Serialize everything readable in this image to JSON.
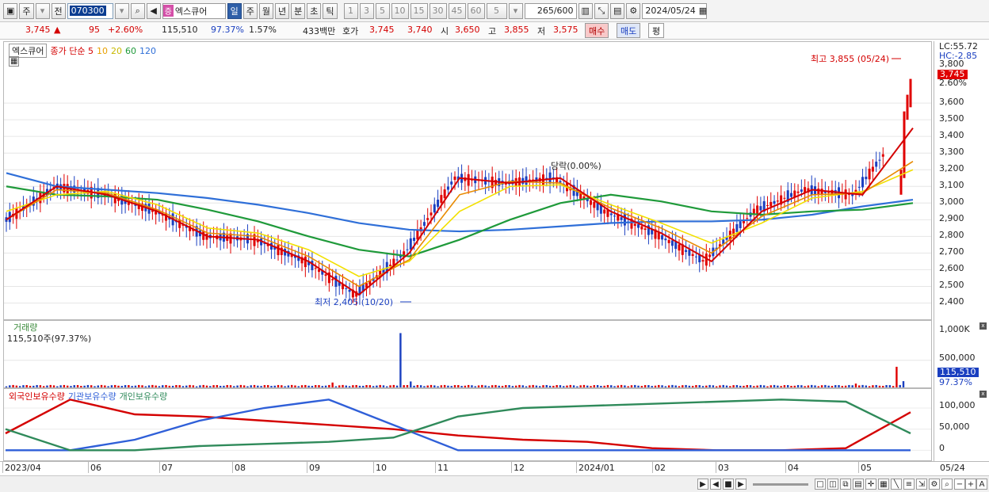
{
  "toolbar": {
    "mode_labels": [
      "주",
      "전"
    ],
    "code": "070300",
    "stock_name": "엑스큐어",
    "name_badge": "증",
    "periods": [
      "일",
      "주",
      "월",
      "년",
      "분",
      "초",
      "틱"
    ],
    "active_period": "일",
    "minutes": [
      "1",
      "3",
      "5",
      "10",
      "15",
      "30",
      "45",
      "60"
    ],
    "interval_value": "5",
    "count": "265",
    "count_total": "/600",
    "date": "2024/05/24"
  },
  "quote": {
    "price": "3,745",
    "change": "95",
    "change_pct": "+2.60%",
    "volume": "115,510",
    "vol_ratio": "97.37%",
    "turnover": "1.57%",
    "amount": "433백만",
    "bid_label": "호가",
    "ask": "3,745",
    "bid": "3,740",
    "open_label": "시",
    "open": "3,650",
    "high_label": "고",
    "high": "3,855",
    "low_label": "저",
    "low": "3,575",
    "buy": "매수",
    "sell": "매도",
    "avg": "평"
  },
  "price_panel": {
    "stock_tag": "엑스큐어",
    "legend": [
      {
        "label": "종가 단순 5",
        "color": "#d40000"
      },
      {
        "label": "10",
        "color": "#e8a000"
      },
      {
        "label": "20",
        "color": "#e6d800"
      },
      {
        "label": "60",
        "color": "#1f9a3a"
      },
      {
        "label": "120",
        "color": "#2f6fd8"
      }
    ],
    "lc_label": "LC:55.72",
    "hc_label": "HC:-2.85",
    "current_price": "3,745",
    "current_pct": "2.60%",
    "high_annot": "최고 3,855 (05/24)",
    "low_annot": "최저 2,405 (10/20)",
    "event_annot": "당락(0.00%)",
    "y_ticks": [
      "3,800",
      "3,600",
      "3,500",
      "3,400",
      "3,300",
      "3,200",
      "3,100",
      "3,000",
      "2,900",
      "2,800",
      "2,700",
      "2,600",
      "2,500",
      "2,400"
    ]
  },
  "volume_panel": {
    "title": "거래량",
    "sub": "115,510주(97.37%)",
    "ticks": [
      "1,000K",
      "500,000"
    ],
    "current": "115,510",
    "current_pct": "97.37%"
  },
  "holding_panel": {
    "legend": [
      "외국인보유수량",
      "기관보유수량",
      "개인보유수량"
    ],
    "ticks": [
      "100,000",
      "50,000",
      "0"
    ]
  },
  "x_axis": [
    "2023/04",
    "06",
    "07",
    "08",
    "09",
    "10",
    "11",
    "12",
    "2024/01",
    "02",
    "03",
    "04",
    "05"
  ],
  "x_last": "05/24",
  "chart_data": [
    {
      "type": "line",
      "title": "",
      "series": [
        {
          "name": "종가 단순 5",
          "values": [
            2900,
            3100,
            3050,
            2950,
            2800,
            2780,
            2650,
            2450,
            2700,
            3150,
            3120,
            3150,
            2950,
            2820,
            2650,
            2950,
            3080,
            3050,
            3450
          ]
        },
        {
          "name": "10",
          "values": [
            2900,
            3080,
            3060,
            2960,
            2820,
            2800,
            2680,
            2500,
            2660,
            3050,
            3130,
            3120,
            2970,
            2850,
            2700,
            2920,
            3050,
            3060,
            3250
          ]
        },
        {
          "name": "20",
          "values": [
            2950,
            3050,
            3070,
            2990,
            2850,
            2820,
            2720,
            2560,
            2650,
            2950,
            3100,
            3110,
            2990,
            2880,
            2760,
            2880,
            3030,
            3070,
            3200
          ]
        },
        {
          "name": "60",
          "values": [
            3100,
            3050,
            3040,
            3020,
            2960,
            2890,
            2800,
            2720,
            2680,
            2780,
            2900,
            3000,
            3050,
            3010,
            2950,
            2930,
            2950,
            2960,
            3000
          ]
        },
        {
          "name": "120",
          "values": [
            3180,
            3100,
            3080,
            3060,
            3030,
            2990,
            2940,
            2880,
            2840,
            2830,
            2840,
            2860,
            2880,
            2890,
            2890,
            2900,
            2930,
            2980,
            3020
          ]
        }
      ],
      "ylim": [
        2350,
        3900
      ],
      "x": [
        "2023/04",
        "06",
        "07",
        "08",
        "09",
        "10",
        "11",
        "12",
        "2024/01",
        "02",
        "03",
        "04",
        "05"
      ]
    },
    {
      "type": "bar",
      "title": "거래량",
      "values": [
        40000,
        30000,
        30000,
        25000,
        30000,
        20000,
        20000,
        20000,
        90000,
        20000,
        1000000,
        40000,
        25000,
        20000,
        20000,
        30000,
        20000,
        30000,
        380000,
        115510
      ],
      "ylim": [
        0,
        1050000
      ]
    },
    {
      "type": "line",
      "series": [
        {
          "name": "외국인보유수량",
          "values": [
            40000,
            120000,
            85000,
            80000,
            70000,
            60000,
            50000,
            35000,
            25000,
            20000,
            5000,
            0,
            0,
            5000,
            90000
          ]
        },
        {
          "name": "기관보유수량",
          "values": [
            0,
            0,
            25000,
            70000,
            100000,
            120000,
            60000,
            0,
            0,
            0,
            0,
            0,
            0,
            0,
            0
          ]
        },
        {
          "name": "개인보유수량",
          "values": [
            50000,
            0,
            0,
            10000,
            15000,
            20000,
            30000,
            80000,
            100000,
            105000,
            110000,
            115000,
            120000,
            115000,
            40000
          ]
        }
      ],
      "ylim": [
        -20000,
        130000
      ]
    }
  ]
}
